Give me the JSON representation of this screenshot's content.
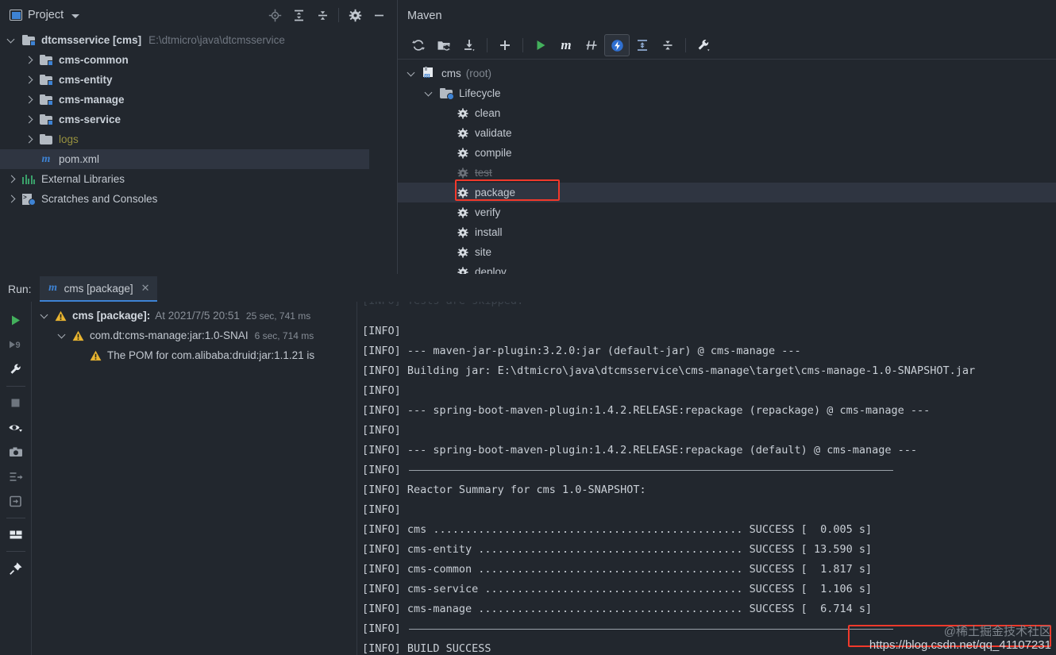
{
  "project": {
    "title": "Project",
    "icons": [
      "project-view-icon",
      "locate-icon",
      "expand-all-icon",
      "collapse-all-icon",
      "settings-gear-icon",
      "hide-icon"
    ],
    "tree": [
      {
        "label": "dtcmsservice [cms]",
        "sub": "E:\\dtmicro\\java\\dtcmsservice",
        "icon": "module-folder-icon",
        "arrow": "down",
        "indent": 0,
        "selected": false,
        "style": "bold"
      },
      {
        "label": "cms-common",
        "sub": "",
        "icon": "module-folder-icon",
        "arrow": "right",
        "indent": 1,
        "selected": false,
        "style": "bold"
      },
      {
        "label": "cms-entity",
        "sub": "",
        "icon": "module-folder-icon",
        "arrow": "right",
        "indent": 1,
        "selected": false,
        "style": "bold"
      },
      {
        "label": "cms-manage",
        "sub": "",
        "icon": "module-folder-icon",
        "arrow": "right",
        "indent": 1,
        "selected": false,
        "style": "bold"
      },
      {
        "label": "cms-service",
        "sub": "",
        "icon": "module-folder-icon",
        "arrow": "right",
        "indent": 1,
        "selected": false,
        "style": "bold"
      },
      {
        "label": "logs",
        "sub": "",
        "icon": "folder-icon",
        "arrow": "right",
        "indent": 1,
        "selected": false,
        "style": "olive"
      },
      {
        "label": "pom.xml",
        "sub": "",
        "icon": "maven-file-icon",
        "arrow": "none",
        "indent": 1,
        "selected": true,
        "style": "plain"
      },
      {
        "label": "External Libraries",
        "sub": "",
        "icon": "libraries-icon",
        "arrow": "right",
        "indent": 0,
        "selected": false,
        "style": "plain"
      },
      {
        "label": "Scratches and Consoles",
        "sub": "",
        "icon": "scratches-icon",
        "arrow": "right",
        "indent": 0,
        "selected": false,
        "style": "plain"
      }
    ]
  },
  "maven": {
    "title": "Maven",
    "toolbar": [
      "reload-all-projects-icon",
      "add-maven-project-icon",
      "download-sources-icon",
      "add-icon",
      "run-maven-build-icon",
      "execute-maven-goal-icon",
      "toggle-skip-tests-icon",
      "toggle-offline-mode-icon",
      "expand-all-icon",
      "collapse-all-icon",
      "maven-settings-icon"
    ],
    "tree": [
      {
        "label": "cms",
        "suffix": "(root)",
        "icon": "maven-project-icon",
        "arrow": "down",
        "indent": 0,
        "state": "normal",
        "selected": false
      },
      {
        "label": "Lifecycle",
        "suffix": "",
        "icon": "lifecycle-folder-icon",
        "arrow": "down",
        "indent": 1,
        "state": "normal",
        "selected": false
      },
      {
        "label": "clean",
        "suffix": "",
        "icon": "goal-gear-icon",
        "arrow": "none",
        "indent": 2,
        "state": "normal",
        "selected": false
      },
      {
        "label": "validate",
        "suffix": "",
        "icon": "goal-gear-icon",
        "arrow": "none",
        "indent": 2,
        "state": "normal",
        "selected": false
      },
      {
        "label": "compile",
        "suffix": "",
        "icon": "goal-gear-icon",
        "arrow": "none",
        "indent": 2,
        "state": "normal",
        "selected": false
      },
      {
        "label": "test",
        "suffix": "",
        "icon": "goal-gear-icon",
        "arrow": "none",
        "indent": 2,
        "state": "skipped",
        "selected": false
      },
      {
        "label": "package",
        "suffix": "",
        "icon": "goal-gear-icon",
        "arrow": "none",
        "indent": 2,
        "state": "normal",
        "selected": true
      },
      {
        "label": "verify",
        "suffix": "",
        "icon": "goal-gear-icon",
        "arrow": "none",
        "indent": 2,
        "state": "normal",
        "selected": false
      },
      {
        "label": "install",
        "suffix": "",
        "icon": "goal-gear-icon",
        "arrow": "none",
        "indent": 2,
        "state": "normal",
        "selected": false
      },
      {
        "label": "site",
        "suffix": "",
        "icon": "goal-gear-icon",
        "arrow": "none",
        "indent": 2,
        "state": "normal",
        "selected": false
      },
      {
        "label": "deploy",
        "suffix": "",
        "icon": "goal-gear-icon",
        "arrow": "none",
        "indent": 2,
        "state": "normal",
        "selected": false
      }
    ],
    "highlight_target": "package"
  },
  "run": {
    "label": "Run:",
    "tab": {
      "title": "cms [package]",
      "icon": "maven-file-icon",
      "close": "✕"
    },
    "sidebar_icons": [
      "rerun-icon",
      "rerun-failed-icon",
      "edit-configurations-wrench-icon",
      "stop-icon",
      "toggle-tasks-eye-icon",
      "screenshot-camera-icon",
      "expand-failed-icon",
      "export-icon",
      "layout-icon",
      "pin-tab-icon"
    ],
    "tree": [
      {
        "arrow": "down",
        "icon": "warning-icon",
        "indent": 0,
        "label": "cms [package]:",
        "bold": true,
        "meta": "At 2021/7/5 20:51",
        "time": "25 sec, 741 ms"
      },
      {
        "arrow": "down",
        "icon": "warning-icon",
        "indent": 1,
        "label": "com.dt:cms-manage:jar:1.0-SNAI",
        "bold": false,
        "meta": "",
        "time": "6 sec, 714 ms"
      },
      {
        "arrow": "none",
        "icon": "warning-icon",
        "indent": 2,
        "label": "The POM for com.alibaba:druid:jar:1.1.21 is",
        "bold": false,
        "meta": "",
        "time": ""
      }
    ]
  },
  "console": {
    "clipped_top_line": "[INFO] Tests are skipped.",
    "lines": [
      "[INFO]",
      "[INFO] --- maven-jar-plugin:3.2.0:jar (default-jar) @ cms-manage ---",
      "[INFO] Building jar: E:\\dtmicro\\java\\dtcmsservice\\cms-manage\\target\\cms-manage-1.0-SNAPSHOT.jar",
      "[INFO]",
      "[INFO] --- spring-boot-maven-plugin:1.4.2.RELEASE:repackage (repackage) @ cms-manage ---",
      "[INFO]",
      "[INFO] --- spring-boot-maven-plugin:1.4.2.RELEASE:repackage (default) @ cms-manage ---",
      "[INFO] ",
      "[INFO] Reactor Summary for cms 1.0-SNAPSHOT:",
      "[INFO]",
      "[INFO] cms ................................................ SUCCESS [  0.005 s]",
      "[INFO] cms-entity ......................................... SUCCESS [ 13.590 s]",
      "[INFO] cms-common ......................................... SUCCESS [  1.817 s]",
      "[INFO] cms-service ........................................ SUCCESS [  1.106 s]",
      "[INFO] cms-manage ......................................... SUCCESS [  6.714 s]",
      "[INFO] ",
      "[INFO] BUILD SUCCESS"
    ],
    "highlight_text": "cms-manage-1.0-SNAPSHOT.jar",
    "reactor_modules": [
      "cms",
      "cms-entity",
      "cms-common",
      "cms-service",
      "cms-manage"
    ],
    "reactor_status": [
      "SUCCESS",
      "SUCCESS",
      "SUCCESS",
      "SUCCESS",
      "SUCCESS"
    ],
    "reactor_times": [
      "0.005 s",
      "13.590 s",
      "1.817 s",
      "1.106 s",
      "6.714 s"
    ],
    "build_result": "BUILD SUCCESS"
  },
  "watermark": {
    "line1": "@稀土掘金技术社区",
    "line2": "https://blog.csdn.net/qq_41107231"
  },
  "colors": {
    "background": "#22272e",
    "selection": "#2f3541",
    "accent_blue": "#3e83d4",
    "highlight_red": "#f2392b",
    "warning_yellow": "#e8b431",
    "run_green": "#4caf67",
    "text": "#c3c9d1",
    "dim_text": "#6f7680",
    "olive": "#97913f"
  }
}
